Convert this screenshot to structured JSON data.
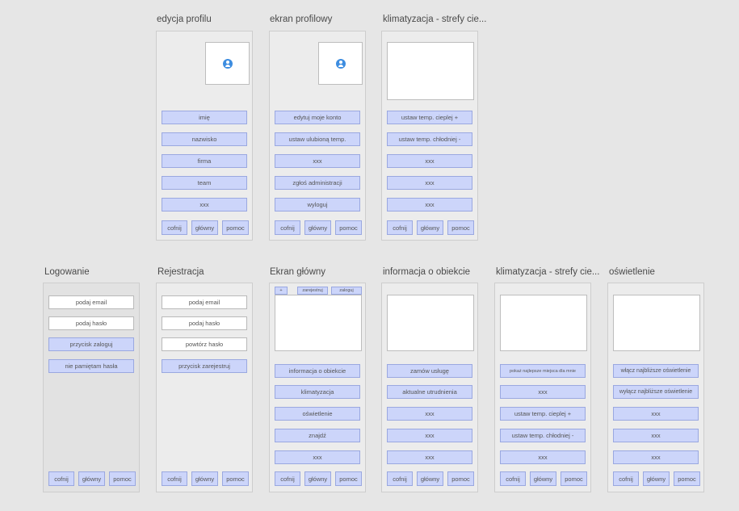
{
  "frames": {
    "edycja_profilu": {
      "title": "edycja profilu",
      "buttons": [
        "imię",
        "nazwisko",
        "firma",
        "team",
        "xxx"
      ],
      "nav": [
        "cofnij",
        "główny",
        "pomoc"
      ]
    },
    "ekran_profilowy": {
      "title": "ekran profilowy",
      "buttons": [
        "edytuj moje konto",
        "ustaw ulubioną temp.",
        "xxx",
        "zgłoś administracji",
        "wyloguj"
      ],
      "nav": [
        "cofnij",
        "główny",
        "pomoc"
      ]
    },
    "klimatyzacja_top": {
      "title": "klimatyzacja - strefy cie...",
      "buttons": [
        "ustaw temp. cieplej +",
        "ustaw temp. chłodniej -",
        "xxx",
        "xxx",
        "xxx"
      ],
      "nav": [
        "cofnij",
        "główny",
        "pomoc"
      ]
    },
    "logowanie": {
      "title": "Logowanie",
      "inputs": [
        "podaj email",
        "podaj hasło"
      ],
      "buttons": [
        "przycisk zaloguj",
        "nie pamiętam hasła"
      ],
      "nav": [
        "cofnij",
        "główny",
        "pomoc"
      ]
    },
    "rejestracja": {
      "title": "Rejestracja",
      "inputs": [
        "podaj email",
        "podaj hasło",
        "powtórz hasło"
      ],
      "buttons": [
        "przycisk zarejestruj"
      ],
      "nav": [
        "cofnij",
        "główny",
        "pomoc"
      ]
    },
    "ekran_glowny": {
      "title": "Ekran główny",
      "top_buttons": [
        "+",
        "zarejestruj",
        "zaloguj"
      ],
      "buttons": [
        "informacja o obiekcie",
        "klimatyzacja",
        "oświetlenie",
        "znajdź",
        "xxx"
      ],
      "nav": [
        "cofnij",
        "główny",
        "pomoc"
      ]
    },
    "informacja": {
      "title": "informacja o obiekcie",
      "buttons": [
        "zamów usługę",
        "aktualne utrudnienia",
        "xxx",
        "xxx",
        "xxx"
      ],
      "nav": [
        "cofnij",
        "główny",
        "pomoc"
      ]
    },
    "klimatyzacja_bottom": {
      "title": "klimatyzacja - strefy cie...",
      "buttons": [
        "pokaż najlepsze miejsca dla mnie",
        "xxx",
        "ustaw temp. cieplej +",
        "ustaw temp. chłodniej -",
        "xxx"
      ],
      "nav": [
        "cofnij",
        "główny",
        "pomoc"
      ]
    },
    "oswietlenie": {
      "title": "oświetlenie",
      "buttons": [
        "włącz najbliższe oświetlenie",
        "wyłącz najbliższe oświetlenie",
        "xxx",
        "xxx",
        "xxx"
      ],
      "nav": [
        "cofnij",
        "główny",
        "pomoc"
      ]
    }
  },
  "colors": {
    "background": "#e6e6e6",
    "button_fill": "#ccd5fa",
    "button_border": "#9aa8e0",
    "avatar": "#3d8de0"
  }
}
